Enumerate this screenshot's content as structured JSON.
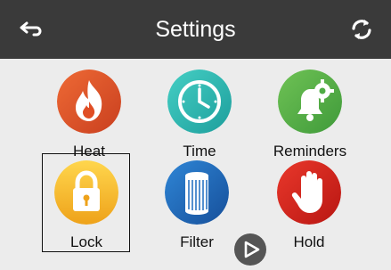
{
  "header": {
    "title": "Settings",
    "back_icon": "back-arrow-icon",
    "refresh_icon": "refresh-icon"
  },
  "tiles": [
    {
      "label": "Heat",
      "icon": "flame-icon",
      "color": "#e8552b"
    },
    {
      "label": "Time",
      "icon": "clock-icon",
      "color": "#2bb6b0"
    },
    {
      "label": "Reminders",
      "icon": "bell-gear-icon",
      "color": "#5bb247"
    },
    {
      "label": "Lock",
      "icon": "padlock-icon",
      "color": "#f2b022",
      "selected": true
    },
    {
      "label": "Filter",
      "icon": "filter-cartridge-icon",
      "color": "#1f6bbd"
    },
    {
      "label": "Hold",
      "icon": "hand-stop-icon",
      "color": "#d9261f"
    }
  ],
  "play_icon": "play-icon",
  "colors": {
    "header_bg": "#3a3a3a",
    "page_bg": "#ececec"
  }
}
